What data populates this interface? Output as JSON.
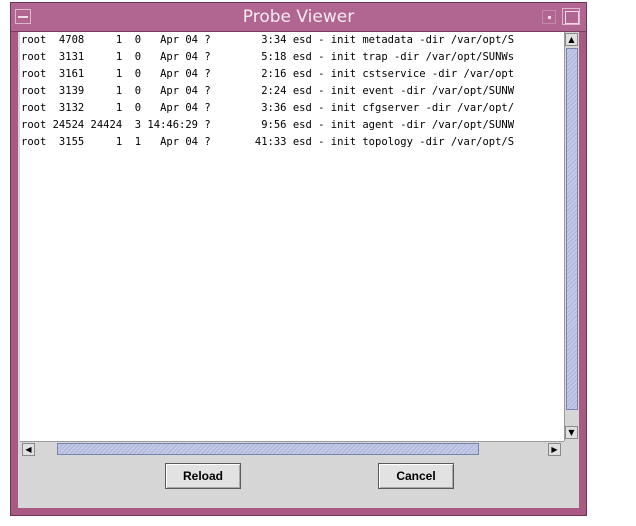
{
  "window": {
    "title": "Probe Viewer"
  },
  "process_list": {
    "rows": [
      "root  4708     1  0   Apr 04 ?        3:34 esd - init metadata -dir /var/opt/S",
      "root  3131     1  0   Apr 04 ?        5:18 esd - init trap -dir /var/opt/SUNWs",
      "root  3161     1  0   Apr 04 ?        2:16 esd - init cstservice -dir /var/opt",
      "root  3139     1  0   Apr 04 ?        2:24 esd - init event -dir /var/opt/SUNW",
      "root  3132     1  0   Apr 04 ?        3:36 esd - init cfgserver -dir /var/opt/",
      "root 24524 24424  3 14:46:29 ?        9:56 esd - init agent -dir /var/opt/SUNW",
      "root  3155     1  1   Apr 04 ?       41:33 esd - init topology -dir /var/opt/S"
    ]
  },
  "scrollbars": {
    "up_arrow": "▲",
    "down_arrow": "▼",
    "left_arrow": "◀",
    "right_arrow": "▶"
  },
  "buttons": {
    "reload": "Reload",
    "cancel": "Cancel"
  }
}
